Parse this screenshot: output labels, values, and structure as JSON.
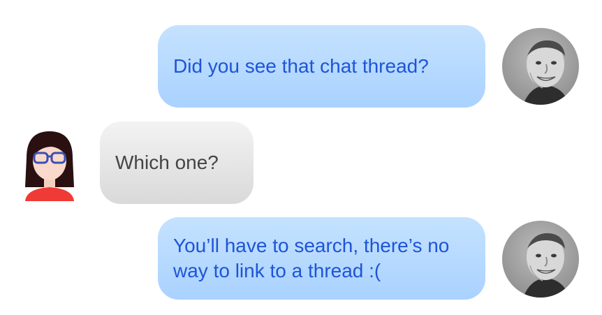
{
  "conversation": {
    "messages": [
      {
        "sender": "man",
        "direction": "outgoing",
        "text": "Did you see that chat thread?"
      },
      {
        "sender": "woman",
        "direction": "incoming",
        "text": "Which one?"
      },
      {
        "sender": "man",
        "direction": "outgoing",
        "text": "You’ll have to search, there’s no way to link to a thread :("
      }
    ]
  },
  "avatars": {
    "man": {
      "icon": "man-photo-avatar-icon"
    },
    "woman": {
      "icon": "woman-with-glasses-avatar-icon"
    }
  },
  "colors": {
    "sent_bubble_top": "#c5e2ff",
    "sent_bubble_bottom": "#a9d2ff",
    "sent_text": "#1e54d8",
    "received_bubble_top": "#f3f3f3",
    "received_bubble_bottom": "#d9d9d9",
    "received_text": "#444444"
  }
}
